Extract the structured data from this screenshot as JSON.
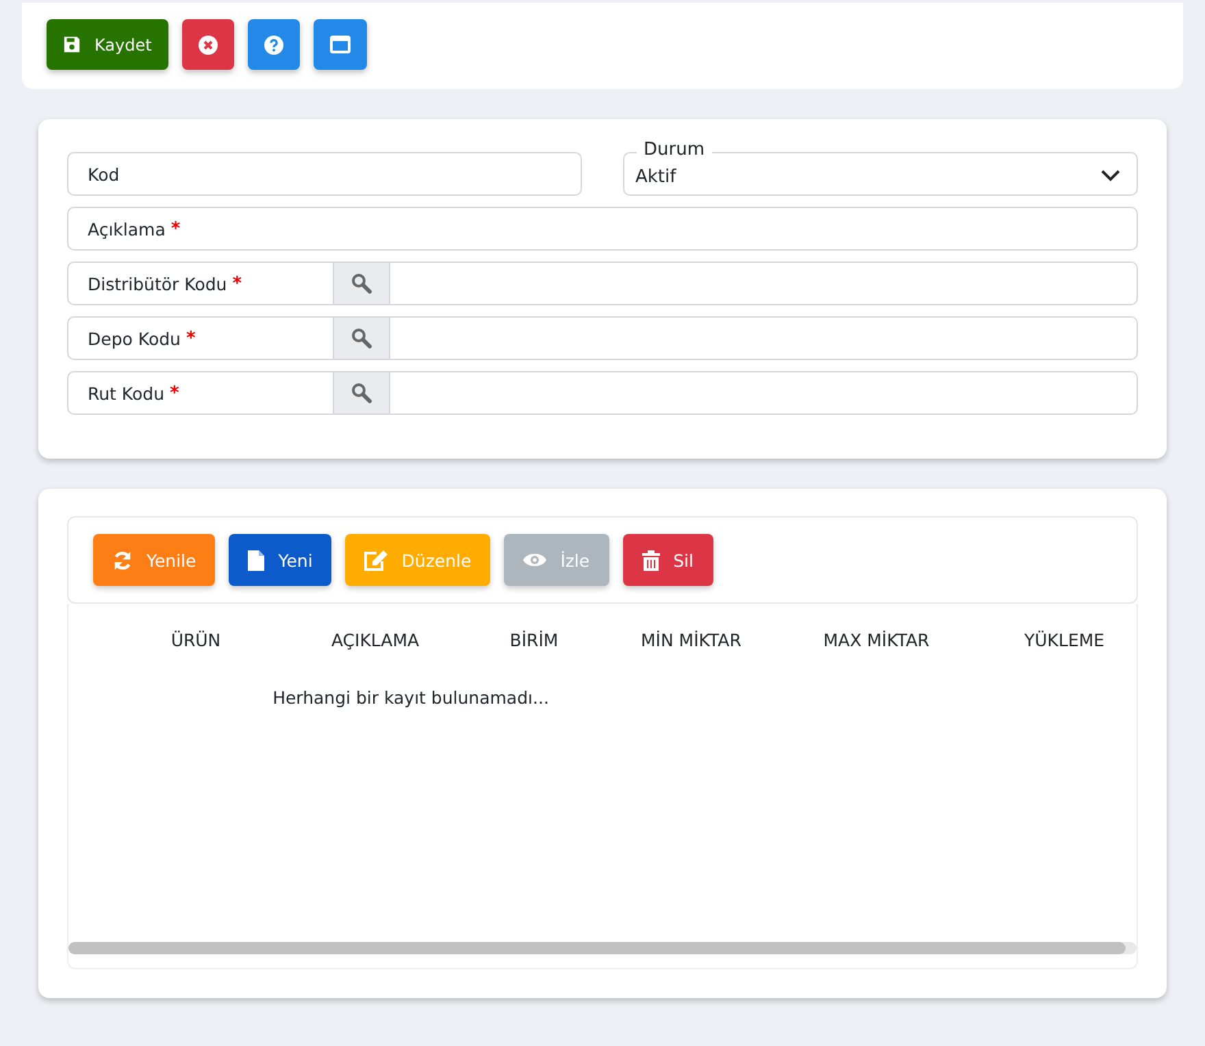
{
  "toolbar": [
    {
      "kind": "save",
      "label": "Kaydet"
    },
    {
      "kind": "cancel"
    },
    {
      "kind": "help"
    },
    {
      "kind": "window"
    }
  ],
  "form": {
    "code": {
      "label": "Kod"
    },
    "status": {
      "label": "Durum",
      "value": "Aktif"
    },
    "description": {
      "label": "Açıklama",
      "required_mark": "*"
    },
    "lookups": [
      {
        "label": "Distribütör Kodu",
        "required_mark": "*"
      },
      {
        "label": "Depo Kodu",
        "required_mark": "*"
      },
      {
        "label": "Rut Kodu",
        "required_mark": "*"
      }
    ]
  },
  "grid": {
    "actions": [
      {
        "kind": "refresh",
        "label": "Yenile",
        "disabled": false
      },
      {
        "kind": "new",
        "label": "Yeni",
        "disabled": false
      },
      {
        "kind": "edit",
        "label": "Düzenle",
        "disabled": false
      },
      {
        "kind": "view",
        "label": "İzle",
        "disabled": true
      },
      {
        "kind": "delete",
        "label": "Sil",
        "disabled": false
      }
    ],
    "columns": [
      "ÜRÜN",
      "AÇIKLAMA",
      "BİRİM",
      "MİN MİKTAR",
      "MAX MİKTAR",
      "YÜKLEME"
    ],
    "empty_message": "Herhangi bir kayıt bulunamadı..."
  }
}
